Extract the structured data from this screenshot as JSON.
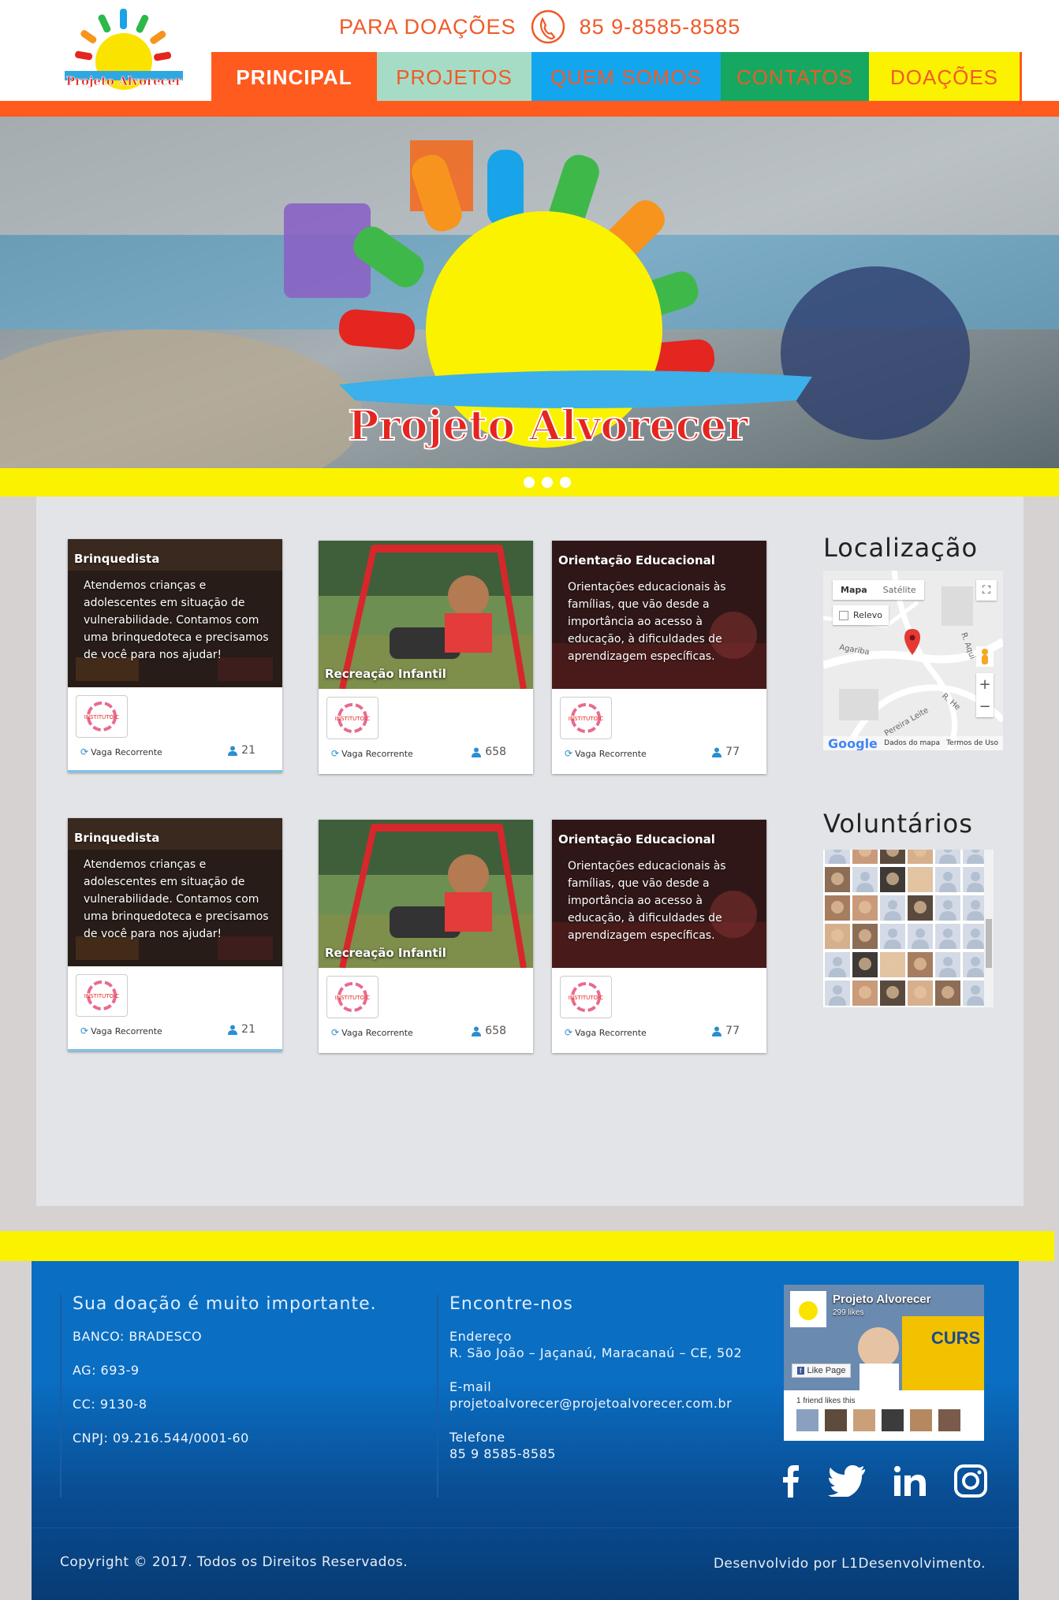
{
  "header": {
    "logo_text": "Projeto Alvorecer",
    "donation_label": "PARA DOAÇÕES",
    "phone": "85 9-8585-8585"
  },
  "nav": [
    {
      "label": "PRINCIPAL",
      "color": "#ff5b1f",
      "active": true
    },
    {
      "label": "PROJETOS",
      "color": "#a6dcc6",
      "active": false
    },
    {
      "label": "QUEM SOMOS",
      "color": "#12a6ee",
      "active": false
    },
    {
      "label": "CONTATOS",
      "color": "#16a861",
      "active": false
    },
    {
      "label": "DOAÇÕES",
      "color": "#fbf200",
      "active": false
    }
  ],
  "hero": {
    "title": "Projeto Alvorecer",
    "dots": 3
  },
  "cards": [
    {
      "title": "Brinquedista",
      "description": "Atendemos crianças e adolescentes em situação de vulnerabilidade. Contamos com uma brinquedoteca e precisamos de você para nos ajudar!",
      "type_label": "Vaga Recorrente",
      "count": "21",
      "image": "toys-room"
    },
    {
      "title": "Recreação Infantil",
      "description": "",
      "type_label": "Vaga Recorrente",
      "count": "658",
      "image": "swing"
    },
    {
      "title": "Orientação Educacional",
      "description": "Orientações educacionais às famílias, que vão desde a importância ao acesso à educação, à dificuldades de aprendizagem específicas.",
      "type_label": "Vaga Recorrente",
      "count": "77",
      "image": "classroom"
    },
    {
      "title": "Brinquedista",
      "description": "Atendemos crianças e adolescentes em situação de vulnerabilidade. Contamos com uma brinquedoteca e precisamos de você para nos ajudar!",
      "type_label": "Vaga Recorrente",
      "count": "21",
      "image": "toys-room"
    },
    {
      "title": "Recreação Infantil",
      "description": "",
      "type_label": "Vaga Recorrente",
      "count": "658",
      "image": "swing"
    },
    {
      "title": "Orientação Educacional",
      "description": "Orientações educacionais às famílias, que vão desde a importância ao acesso à educação, à dificuldades de aprendizagem específicas.",
      "type_label": "Vaga Recorrente",
      "count": "77",
      "image": "classroom"
    }
  ],
  "org_logo_text": "INSTITUTO C",
  "sidebar": {
    "location_title": "Localização",
    "map": {
      "tab_map": "Mapa",
      "tab_satellite": "Satélite",
      "relevo": "Relevo",
      "google": "Google",
      "map_data": "Dados do mapa",
      "terms": "Termos de Uso",
      "streets": [
        "R. Aqui",
        "Agariba",
        "Pereira Leite",
        "R. He"
      ]
    },
    "volunteers_title": "Voluntários"
  },
  "footer": {
    "donation": {
      "title": "Sua doação é muito importante.",
      "bank": "BANCO: BRADESCO",
      "agency": "AG: 693-9",
      "account": "CC: 9130-8",
      "cnpj": "CNPJ: 09.216.544/0001-60"
    },
    "contact": {
      "title": "Encontre-nos",
      "address_label": "Endereço",
      "address": "R. São João – Jaçanaú, Maracanaú – CE, 502",
      "email_label": "E-mail",
      "email": "projetoalvorecer@projetoalvorecer.com.br",
      "phone_label": "Telefone",
      "phone": "85 9 8585-8585"
    },
    "facebook": {
      "page_name": "Projeto Alvorecer",
      "likes": "299 likes",
      "like_button": "Like Page",
      "friends": "1 friend likes this",
      "cover_text": "CURS"
    },
    "social": [
      "facebook-icon",
      "twitter-icon",
      "linkedin-icon",
      "instagram-icon"
    ],
    "copyright": "Copyright © 2017. Todos os Direitos Reservados.",
    "developer": "Desenvolvido por L1Desenvolvimento."
  }
}
